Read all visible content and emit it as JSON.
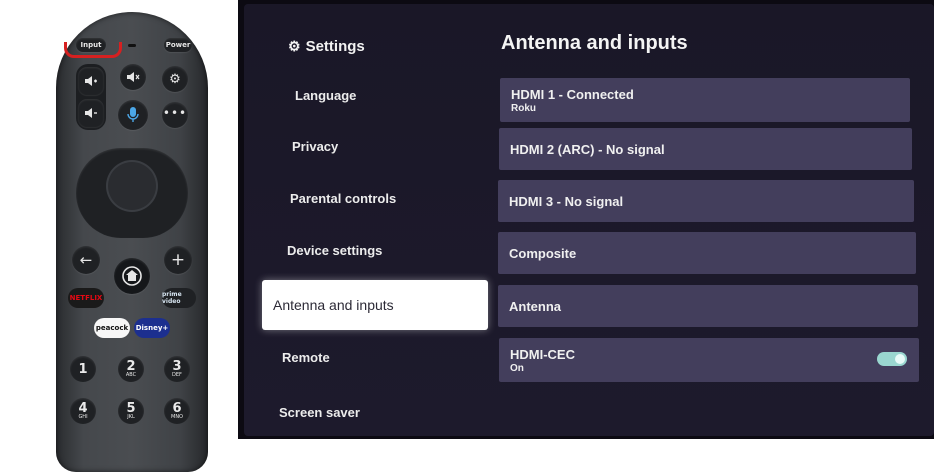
{
  "remote": {
    "input_label": "Input",
    "power_label": "Power",
    "netflix_label": "NETFLIX",
    "prime_label": "prime video",
    "peacock_label": "peacock",
    "disney_label": "Disney+",
    "keys": [
      {
        "digit": "1",
        "letters": ""
      },
      {
        "digit": "2",
        "letters": "ABC"
      },
      {
        "digit": "3",
        "letters": "DEF"
      },
      {
        "digit": "4",
        "letters": "GHI"
      },
      {
        "digit": "5",
        "letters": "JKL"
      },
      {
        "digit": "6",
        "letters": "MNO"
      }
    ],
    "icons": [
      "volume-up-icon",
      "volume-down-icon",
      "mute-icon",
      "gear-icon",
      "microphone-icon",
      "more-icon",
      "back-arrow-icon",
      "home-icon",
      "plus-icon"
    ],
    "colors": {
      "highlight": "#d62020",
      "body": "#45484c",
      "netflix": "#e50914",
      "disney": "#1c2f8f"
    }
  },
  "tv": {
    "settings_title": "Settings",
    "menu": [
      {
        "label": "Language"
      },
      {
        "label": "Privacy"
      },
      {
        "label": "Parental controls"
      },
      {
        "label": "Device settings"
      },
      {
        "label": "Antenna and inputs",
        "selected": true
      },
      {
        "label": "Remote"
      },
      {
        "label": "Screen saver"
      }
    ],
    "content_title": "Antenna and inputs",
    "inputs": [
      {
        "title": "HDMI 1 - Connected",
        "subtitle": "Roku"
      },
      {
        "title": "HDMI 2 (ARC) - No signal",
        "subtitle": ""
      },
      {
        "title": "HDMI 3 - No signal",
        "subtitle": ""
      },
      {
        "title": "Composite",
        "subtitle": ""
      },
      {
        "title": "Antenna",
        "subtitle": ""
      },
      {
        "title": "HDMI-CEC",
        "subtitle": "On",
        "toggle": true
      }
    ],
    "colors": {
      "background": "#1b1829",
      "row": "#433e5c",
      "selected": "#ffffff",
      "toggle": "#9ad7d0"
    }
  }
}
